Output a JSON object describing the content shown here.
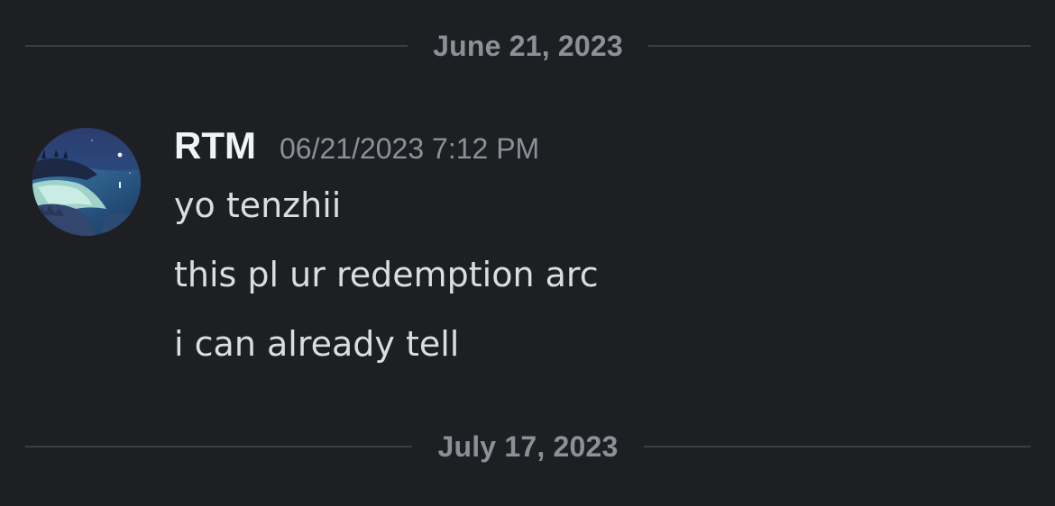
{
  "dividers": [
    {
      "date": "June 21, 2023"
    },
    {
      "date": "July 17, 2023"
    }
  ],
  "message": {
    "author": "RTM",
    "timestamp": "06/21/2023 7:12 PM",
    "lines": [
      "yo tenzhii",
      "this pl ur redemption arc",
      "i can already tell"
    ]
  },
  "colors": {
    "background": "#1e1f23",
    "divider_line": "#3b3d44",
    "muted_text": "#8e9097",
    "username": "#f2f3f5",
    "message_text": "#dbdee1"
  },
  "icons": {
    "avatar": "night-coastline-avatar"
  }
}
